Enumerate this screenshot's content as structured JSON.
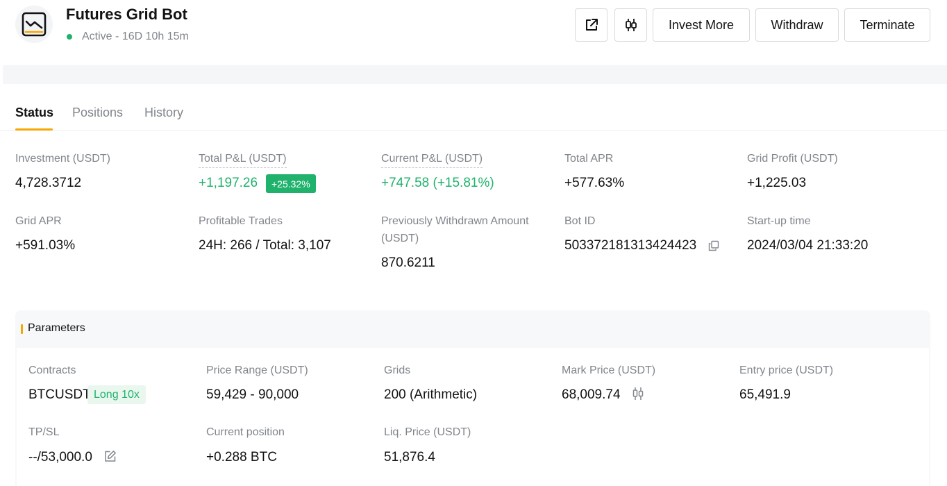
{
  "header": {
    "title": "Futures Grid Bot",
    "status": "Active - 16D 10h 15m",
    "status_color": "#20b26c",
    "icons": [
      "chart-line-icon",
      "share-external-icon",
      "candlestick-icon"
    ],
    "buttons": {
      "invest_more": "Invest More",
      "withdraw": "Withdraw",
      "terminate": "Terminate"
    }
  },
  "tabs": [
    {
      "label": "Status",
      "active": true
    },
    {
      "label": "Positions",
      "active": false
    },
    {
      "label": "History",
      "active": false
    }
  ],
  "stats": {
    "investment_label": "Investment (USDT)",
    "investment_value": "4,728.3712",
    "total_pnl_label": "Total P&L (USDT)",
    "total_pnl_value": "+1,197.26",
    "total_pnl_badge": "+25.32%",
    "current_pnl_label": "Current P&L (USDT)",
    "current_pnl_value": "+747.58 (+15.81%)",
    "total_apr_label": "Total APR",
    "total_apr_value": "+577.63%",
    "grid_profit_label": "Grid Profit (USDT)",
    "grid_profit_value": "+1,225.03",
    "grid_apr_label": "Grid APR",
    "grid_apr_value": "+591.03%",
    "profitable_trades_label": "Profitable Trades",
    "profitable_trades_value": "24H: 266 / Total: 3,107",
    "withdrawn_label_1": "Previously Withdrawn Amount",
    "withdrawn_label_2": "(USDT)",
    "withdrawn_value": "870.6211",
    "bot_id_label": "Bot ID",
    "bot_id_value": "503372181313424423",
    "startup_label": "Start-up time",
    "startup_value": "2024/03/04 21:33:20"
  },
  "parameters": {
    "title": "Parameters",
    "accent_color": "#f7a600",
    "contracts_label": "Contracts",
    "contracts_value": "BTCUSDT",
    "contracts_tag": "Long 10x",
    "price_range_label": "Price Range (USDT)",
    "price_range_value": "59,429 - 90,000",
    "grids_label": "Grids",
    "grids_value": "200 (Arithmetic)",
    "mark_price_label": "Mark Price (USDT)",
    "mark_price_value": "68,009.74",
    "entry_price_label": "Entry price (USDT)",
    "entry_price_value": "65,491.9",
    "tpsl_label": "TP/SL",
    "tpsl_value": "--/53,000.0",
    "current_position_label": "Current position",
    "current_position_value": "+0.288 BTC",
    "liq_price_label": "Liq. Price (USDT)",
    "liq_price_value": "51,876.4"
  }
}
